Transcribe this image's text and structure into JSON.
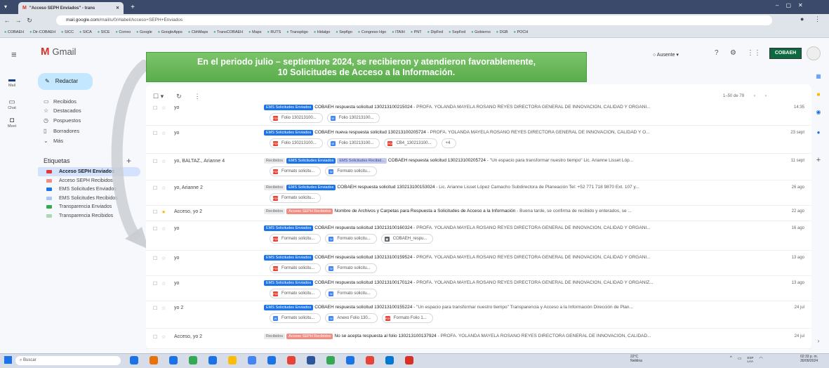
{
  "browser": {
    "tab_title": "\"Acceso SEPH Enviados\" - trans",
    "tab_close": "✕",
    "new_tab": "+",
    "url_host": "mail.google.com",
    "url_path": "/mail/u/0/#label/Acceso+SEPH+Enviados",
    "bookmarks": [
      "COBAEH",
      "Dir-COBAEH",
      "SICC",
      "SICA",
      "SICE",
      "Correo",
      "Google",
      "GoogleApps",
      "CbhMaps",
      "TransCOBAEH",
      "Maps",
      "RUTS",
      "Transptigo",
      "Hidalgo",
      "Sepfigo",
      "Congreso Hgo",
      "ITAIH",
      "PNT",
      "DipFed",
      "SepFed",
      "Gobierno",
      "DGB",
      "POCH"
    ]
  },
  "gmail": {
    "logo_text": "Gmail",
    "status": "Ausente",
    "org_logo": "COBAEH",
    "compose": "Redactar",
    "rail": {
      "mail": "Mail",
      "chat": "Chat",
      "meet": "Meet"
    },
    "nav": [
      "Recibidos",
      "Destacados",
      "Pospuestos",
      "Borradores",
      "Más"
    ],
    "labels_heading": "Etiquetas",
    "labels": [
      {
        "name": "Acceso SEPH Enviados",
        "color": "#e53935",
        "active": true
      },
      {
        "name": "Acceso SEPH Recibidos",
        "color": "#f28b82"
      },
      {
        "name": "EMS Solicitudes Enviados",
        "color": "#1a73e8"
      },
      {
        "name": "EMS Solicitudes Recibidos",
        "color": "#a8c7fa"
      },
      {
        "name": "Transparencia Enviados",
        "color": "#34a853"
      },
      {
        "name": "Transparencia Recibidos",
        "color": "#a8dab5"
      }
    ],
    "paging": "1–50 de 79"
  },
  "banner": {
    "line1": "En el periodo julio – septiembre 2024, se recibieron y atendieron favorablemente,",
    "line2": "10 Solicitudes de Acceso a la Información."
  },
  "emails": [
    {
      "sender": "yo",
      "tags": [
        [
          "EMS Solicitudes Enviados",
          "t-blue"
        ]
      ],
      "title": "COBAEH respuesta solicitud 130213100215024",
      "snippet": " - PROFA. YOLANDA MAYELA ROSANO REYES DIRECTORA GENERAL DE INNOVACIÓN, CALIDAD Y ORGANI...",
      "date": "14:35",
      "chips": [
        [
          "Folio 130213100...",
          "#ea4335",
          "PDF"
        ],
        [
          "Folio 130213100...",
          "#4285f4",
          "W"
        ]
      ]
    },
    {
      "sender": "yo",
      "tags": [
        [
          "EMS Solicitudes Enviados",
          "t-blue"
        ]
      ],
      "title": "COBAEH nueva respuesta solicitud 130213100205724",
      "snippet": " - PROFA. YOLANDA MAYELA ROSANO REYES DIRECTORA GENERAL DE INNOVACIÓN, CALIDAD Y O...",
      "date": "23 sept",
      "chips": [
        [
          "Folio 130213100...",
          "#ea4335",
          "PDF"
        ],
        [
          "Folio 130213100...",
          "#4285f4",
          "W"
        ],
        [
          "CB4_130213100...",
          "#ea4335",
          "PDF"
        ],
        [
          "+4",
          "",
          ""
        ]
      ]
    },
    {
      "sender": "yo, BALTAZ., Arianne 4",
      "tags": [
        [
          "Recibidos",
          "t-grey"
        ],
        [
          "EMS Solicitudes Enviados",
          "t-blue"
        ],
        [
          "EMS Solicitudes Recibid...",
          "t-purple"
        ]
      ],
      "title": "COBAEH respuesta solicitud 130213100205724",
      "snippet": " - \"Un espacio para transformar nuestro tiempo\" Lic. Arianne Lisset Lóp...",
      "date": "11 sept",
      "chips": [
        [
          "Formato solicitu...",
          "#ea4335",
          "PDF"
        ],
        [
          "Formato solicitu...",
          "#4285f4",
          "W"
        ]
      ]
    },
    {
      "sender": "yo, Arianne 2",
      "tags": [
        [
          "Recibidos",
          "t-grey"
        ],
        [
          "EMS Solicitudes Enviados",
          "t-blue"
        ]
      ],
      "title": "COBAEH respuesta solicitud 130213100153024",
      "snippet": " - Lic. Arianne Lisset López Camacho Subdirectora de Planeación Tel: +52 771 718 9870 Ext. 107 y...",
      "date": "26 ago",
      "chips": [
        [
          "Formato solicitu...",
          "#ea4335",
          "PDF"
        ]
      ]
    },
    {
      "sender": "Acceso, yo 2",
      "starred": true,
      "tags": [
        [
          "Recibidos",
          "t-grey"
        ],
        [
          "Acceso SEPH Recibidos",
          "t-red"
        ]
      ],
      "title": "Nombre de Archivos y Carpetas para Respuesta a Solicitudes de Acceso a la Información",
      "snippet": " - Buena tarde, se confirma de recibido y enterados, se ...",
      "date": "22 ago",
      "chips": []
    },
    {
      "sender": "yo",
      "tags": [
        [
          "EMS Solicitudes Enviados",
          "t-blue"
        ]
      ],
      "title": "COBAEH respuesta solicitud 130213100160324",
      "snippet": " - PROFA. YOLANDA MAYELA ROSANO REYES DIRECTORA GENERAL DE INNOVACIÓN, CALIDAD Y ORGANI...",
      "date": "16 ago",
      "chips": [
        [
          "Formato solicitu...",
          "#ea4335",
          "PDF"
        ],
        [
          "Formato solicitu...",
          "#4285f4",
          "W"
        ],
        [
          "COBAEH_respu...",
          "#5f6368",
          "▣"
        ]
      ]
    },
    {
      "sender": "yo",
      "tags": [
        [
          "EMS Solicitudes Enviados",
          "t-blue"
        ]
      ],
      "title": "COBAEH respuesta solicitud 130213100159524",
      "snippet": " - PROFA. YOLANDA MAYELA ROSANO REYES DIRECTORA GENERAL DE INNOVACIÓN, CALIDAD Y ORGANI...",
      "date": "13 ago",
      "chips": [
        [
          "Formato solicitu...",
          "#ea4335",
          "PDF"
        ],
        [
          "Formato solicitu...",
          "#4285f4",
          "W"
        ]
      ]
    },
    {
      "sender": "yo",
      "tags": [
        [
          "EMS Solicitudes Enviados",
          "t-blue"
        ]
      ],
      "title": "COBAEH respuesta solicitud 130213100170124",
      "snippet": " - PROFA. YOLANDA MAYELA ROSANO REYES DIRECTORA GENERAL DE INNOVACIÓN, CALIDAD Y ORGANIZ...",
      "date": "13 ago",
      "chips": [
        [
          "Formato solicitu...",
          "#ea4335",
          "PDF"
        ],
        [
          "Formato solicitu...",
          "#4285f4",
          "W"
        ]
      ]
    },
    {
      "sender": "yo 2",
      "tags": [
        [
          "EMS Solicitudes Enviados",
          "t-blue"
        ]
      ],
      "title": "COBAEH respuesta solicitud 130213100155224",
      "snippet": " - \"Un espacio para transformar nuestro tiempo\" Transparencia y Acceso a la Información Dirección de Plan...",
      "date": "24 jul",
      "chips": [
        [
          "Formato solicitu...",
          "#4285f4",
          "W"
        ],
        [
          "Anexo Folio 130...",
          "#4285f4",
          "W"
        ],
        [
          "Formato Folio 1...",
          "#ea4335",
          "PDF"
        ]
      ]
    },
    {
      "sender": "Acceso, yo 2",
      "tags": [
        [
          "Recibidos",
          "t-grey"
        ],
        [
          "Acceso SEPH Recibidos",
          "t-red"
        ]
      ],
      "title": "No se acepta respuesta al folio 130213100137924",
      "snippet": " - PROFA. YOLANDA MAYELA ROSANO REYES DIRECTORA GENERAL DE INNOVACIÓN, CALIDAD...",
      "date": "24 jul",
      "chips": []
    }
  ],
  "taskbar": {
    "search": "Buscar",
    "weather_temp": "22°C",
    "weather_desc": "Neblina",
    "lang1": "ESP",
    "lang2": "LAA",
    "time": "02:33 p. m.",
    "date": "30/09/2024"
  }
}
